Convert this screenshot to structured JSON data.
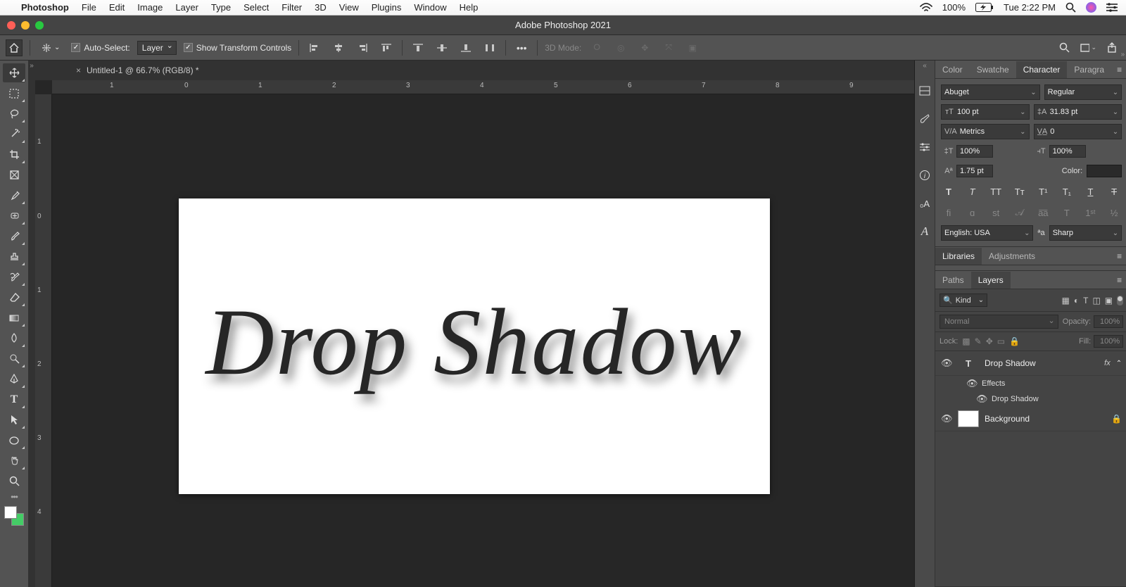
{
  "mac": {
    "appname": "Photoshop",
    "menus": [
      "File",
      "Edit",
      "Image",
      "Layer",
      "Type",
      "Select",
      "Filter",
      "3D",
      "View",
      "Plugins",
      "Window",
      "Help"
    ],
    "battery": "100%",
    "clock": "Tue 2:22 PM"
  },
  "window": {
    "title": "Adobe Photoshop 2021"
  },
  "options": {
    "auto_select_label": "Auto-Select:",
    "auto_select_target": "Layer",
    "show_transform_label": "Show Transform Controls",
    "mode3d_label": "3D Mode:"
  },
  "doc": {
    "tab_title": "Untitled-1 @ 66.7% (RGB/8) *",
    "canvas_text": "Drop Shadow",
    "ruler_h": [
      "1",
      "0",
      "1",
      "2",
      "3",
      "4",
      "5",
      "6",
      "7",
      "8",
      "9"
    ],
    "ruler_v": [
      "1",
      "0",
      "1",
      "2",
      "3",
      "4"
    ]
  },
  "char": {
    "tabs": [
      "Color",
      "Swatche",
      "Character",
      "Paragra"
    ],
    "font": "Abuget",
    "style": "Regular",
    "size": "100 pt",
    "leading": "31.83 pt",
    "kerning": "Metrics",
    "tracking": "0",
    "vscale": "100%",
    "hscale": "100%",
    "baseline": "1.75 pt",
    "color_label": "Color:",
    "lang": "English: USA",
    "aa": "Sharp"
  },
  "lib": {
    "tabs": [
      "Libraries",
      "Adjustments"
    ]
  },
  "layers": {
    "tabs": [
      "Paths",
      "Layers"
    ],
    "kind": "Kind",
    "blend": "Normal",
    "opacity_label": "Opacity:",
    "opacity_value": "100%",
    "lock_label": "Lock:",
    "fill_label": "Fill:",
    "fill_value": "100%",
    "items": [
      {
        "name": "Drop Shadow",
        "type": "text",
        "fx": true
      },
      {
        "name": "Background",
        "type": "bg",
        "locked": true
      }
    ],
    "effects_label": "Effects",
    "effect_item": "Drop Shadow"
  }
}
